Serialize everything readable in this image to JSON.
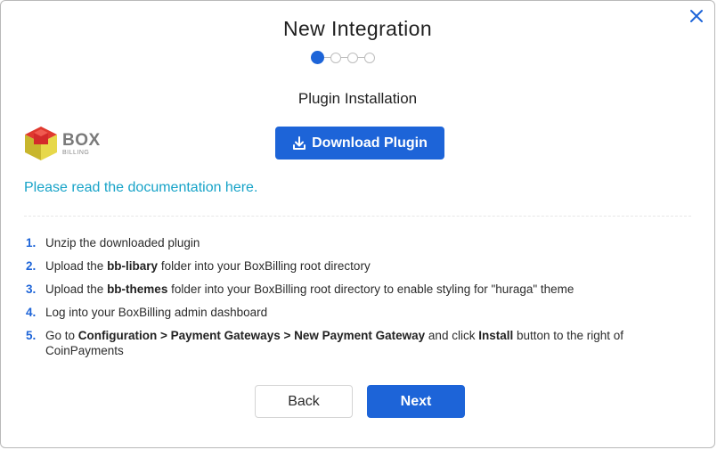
{
  "modal": {
    "title": "New Integration",
    "close_icon": "close-icon",
    "stepper": {
      "total_steps": 4,
      "current_step": 1
    },
    "subtitle": "Plugin Installation"
  },
  "logo": {
    "name": "BoxBilling",
    "big_text": "BOX",
    "small_text": "BILLING"
  },
  "download": {
    "label": "Download Plugin",
    "icon": "download-icon"
  },
  "doc_link": {
    "label": "Please read the documentation here."
  },
  "steps": [
    {
      "num": "1.",
      "parts": [
        {
          "text": "Unzip the downloaded plugin",
          "bold": false
        }
      ]
    },
    {
      "num": "2.",
      "parts": [
        {
          "text": "Upload the ",
          "bold": false
        },
        {
          "text": "bb-libary",
          "bold": true
        },
        {
          "text": " folder into your BoxBilling root directory",
          "bold": false
        }
      ]
    },
    {
      "num": "3.",
      "parts": [
        {
          "text": "Upload the ",
          "bold": false
        },
        {
          "text": "bb-themes",
          "bold": true
        },
        {
          "text": " folder into your BoxBilling root directory to enable styling for \"huraga\" theme",
          "bold": false
        }
      ]
    },
    {
      "num": "4.",
      "parts": [
        {
          "text": "Log into your BoxBilling admin dashboard",
          "bold": false
        }
      ]
    },
    {
      "num": "5.",
      "parts": [
        {
          "text": "Go to ",
          "bold": false
        },
        {
          "text": "Configuration > Payment Gateways > New Payment Gateway",
          "bold": true
        },
        {
          "text": " and click ",
          "bold": false
        },
        {
          "text": "Install",
          "bold": true
        },
        {
          "text": " button to the right of CoinPayments",
          "bold": false
        }
      ]
    }
  ],
  "footer": {
    "back_label": "Back",
    "next_label": "Next"
  },
  "colors": {
    "primary": "#1d64d8",
    "link": "#17a3c8",
    "text": "#232323"
  }
}
